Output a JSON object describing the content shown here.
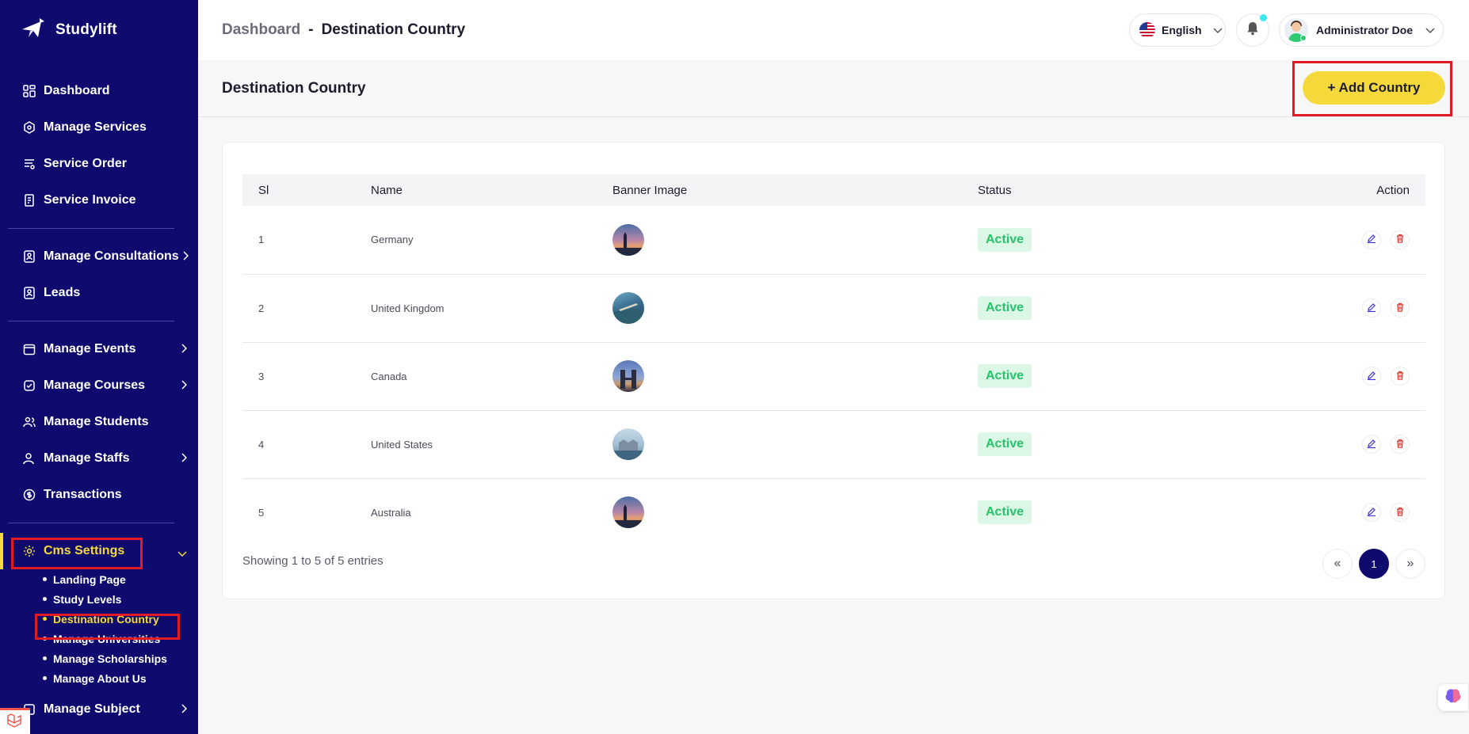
{
  "brand": {
    "name": "Studylift"
  },
  "sidebar": {
    "items": [
      {
        "label": "Dashboard",
        "icon": "dashboard-icon"
      },
      {
        "label": "Manage Services",
        "icon": "services-icon"
      },
      {
        "label": "Service Order",
        "icon": "order-icon"
      },
      {
        "label": "Service Invoice",
        "icon": "invoice-icon"
      },
      {
        "label": "Manage Consultations",
        "icon": "consultation-icon"
      },
      {
        "label": "Leads",
        "icon": "leads-icon"
      },
      {
        "label": "Manage Events",
        "icon": "calendar-icon"
      },
      {
        "label": "Manage Courses",
        "icon": "courses-icon"
      },
      {
        "label": "Manage Students",
        "icon": "students-icon"
      },
      {
        "label": "Manage Staffs",
        "icon": "staffs-icon"
      },
      {
        "label": "Transactions",
        "icon": "transactions-icon"
      },
      {
        "label": "Cms Settings",
        "icon": "cms-icon"
      },
      {
        "label": "Manage Subject",
        "icon": "subject-icon"
      }
    ],
    "cms_sub": [
      "Landing Page",
      "Study Levels",
      "Destination Country",
      "Manage Universities",
      "Manage Scholarships",
      "Manage About Us"
    ]
  },
  "topbar": {
    "breadcrumb_root": "Dashboard",
    "breadcrumb_sep": "-",
    "breadcrumb_current": "Destination Country",
    "language": "English",
    "user_name": "Administrator Doe"
  },
  "page": {
    "title": "Destination Country",
    "add_button": "+ Add Country"
  },
  "table": {
    "headers": [
      "Sl",
      "Name",
      "Banner Image",
      "Status",
      "Action"
    ],
    "rows": [
      {
        "sl": "1",
        "name": "Germany",
        "status": "Active"
      },
      {
        "sl": "2",
        "name": "United Kingdom",
        "status": "Active"
      },
      {
        "sl": "3",
        "name": "Canada",
        "status": "Active"
      },
      {
        "sl": "4",
        "name": "United States",
        "status": "Active"
      },
      {
        "sl": "5",
        "name": "Australia",
        "status": "Active"
      }
    ],
    "info": "Showing 1 to 5 of 5 entries",
    "pagination": {
      "prev": "«",
      "current": "1",
      "next": "»"
    }
  },
  "colors": {
    "sidebar": "#0f0a6e",
    "accent": "#f5d93b",
    "active_badge": "#27c26a"
  }
}
